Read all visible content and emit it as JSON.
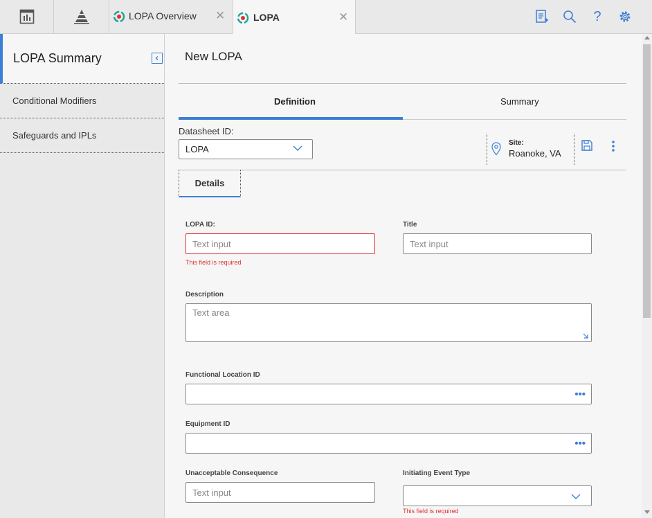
{
  "tabs": [
    {
      "label": "LOPA Overview",
      "icon": "lopa-icon",
      "active": false
    },
    {
      "label": "LOPA",
      "icon": "lopa-icon",
      "active": true
    }
  ],
  "toolbar_icons": [
    "report-icon",
    "search-icon",
    "help-icon",
    "gear-icon"
  ],
  "sidebar": {
    "title": "LOPA Summary",
    "items": [
      {
        "label": "Conditional Modifiers"
      },
      {
        "label": "Safeguards and IPLs"
      }
    ]
  },
  "main": {
    "title": "New LOPA",
    "tabs": [
      {
        "label": "Definition",
        "active": true
      },
      {
        "label": "Summary",
        "active": false
      }
    ],
    "datasheet_label": "Datasheet ID:",
    "datasheet_value": "LOPA",
    "site_label": "Site:",
    "site_value": "Roanoke, VA",
    "details_tab": "Details"
  },
  "form": {
    "lopa_id": {
      "label": "LOPA ID:",
      "placeholder": "Text input",
      "error": "This field is required"
    },
    "title": {
      "label": "Title",
      "placeholder": "Text input"
    },
    "description": {
      "label": "Description",
      "placeholder": "Text area"
    },
    "functional_location": {
      "label": "Functional Location ID",
      "value": ""
    },
    "equipment": {
      "label": "Equipment ID",
      "value": ""
    },
    "unacceptable_consequence": {
      "label": "Unacceptable Consequence",
      "placeholder": "Text input"
    },
    "initiating_event_type": {
      "label": "Initiating Event Type",
      "value": "",
      "error": "This field is required"
    }
  },
  "colors": {
    "accent": "#3c7fd6",
    "error": "#d33333",
    "teal": "#1aa39a"
  }
}
